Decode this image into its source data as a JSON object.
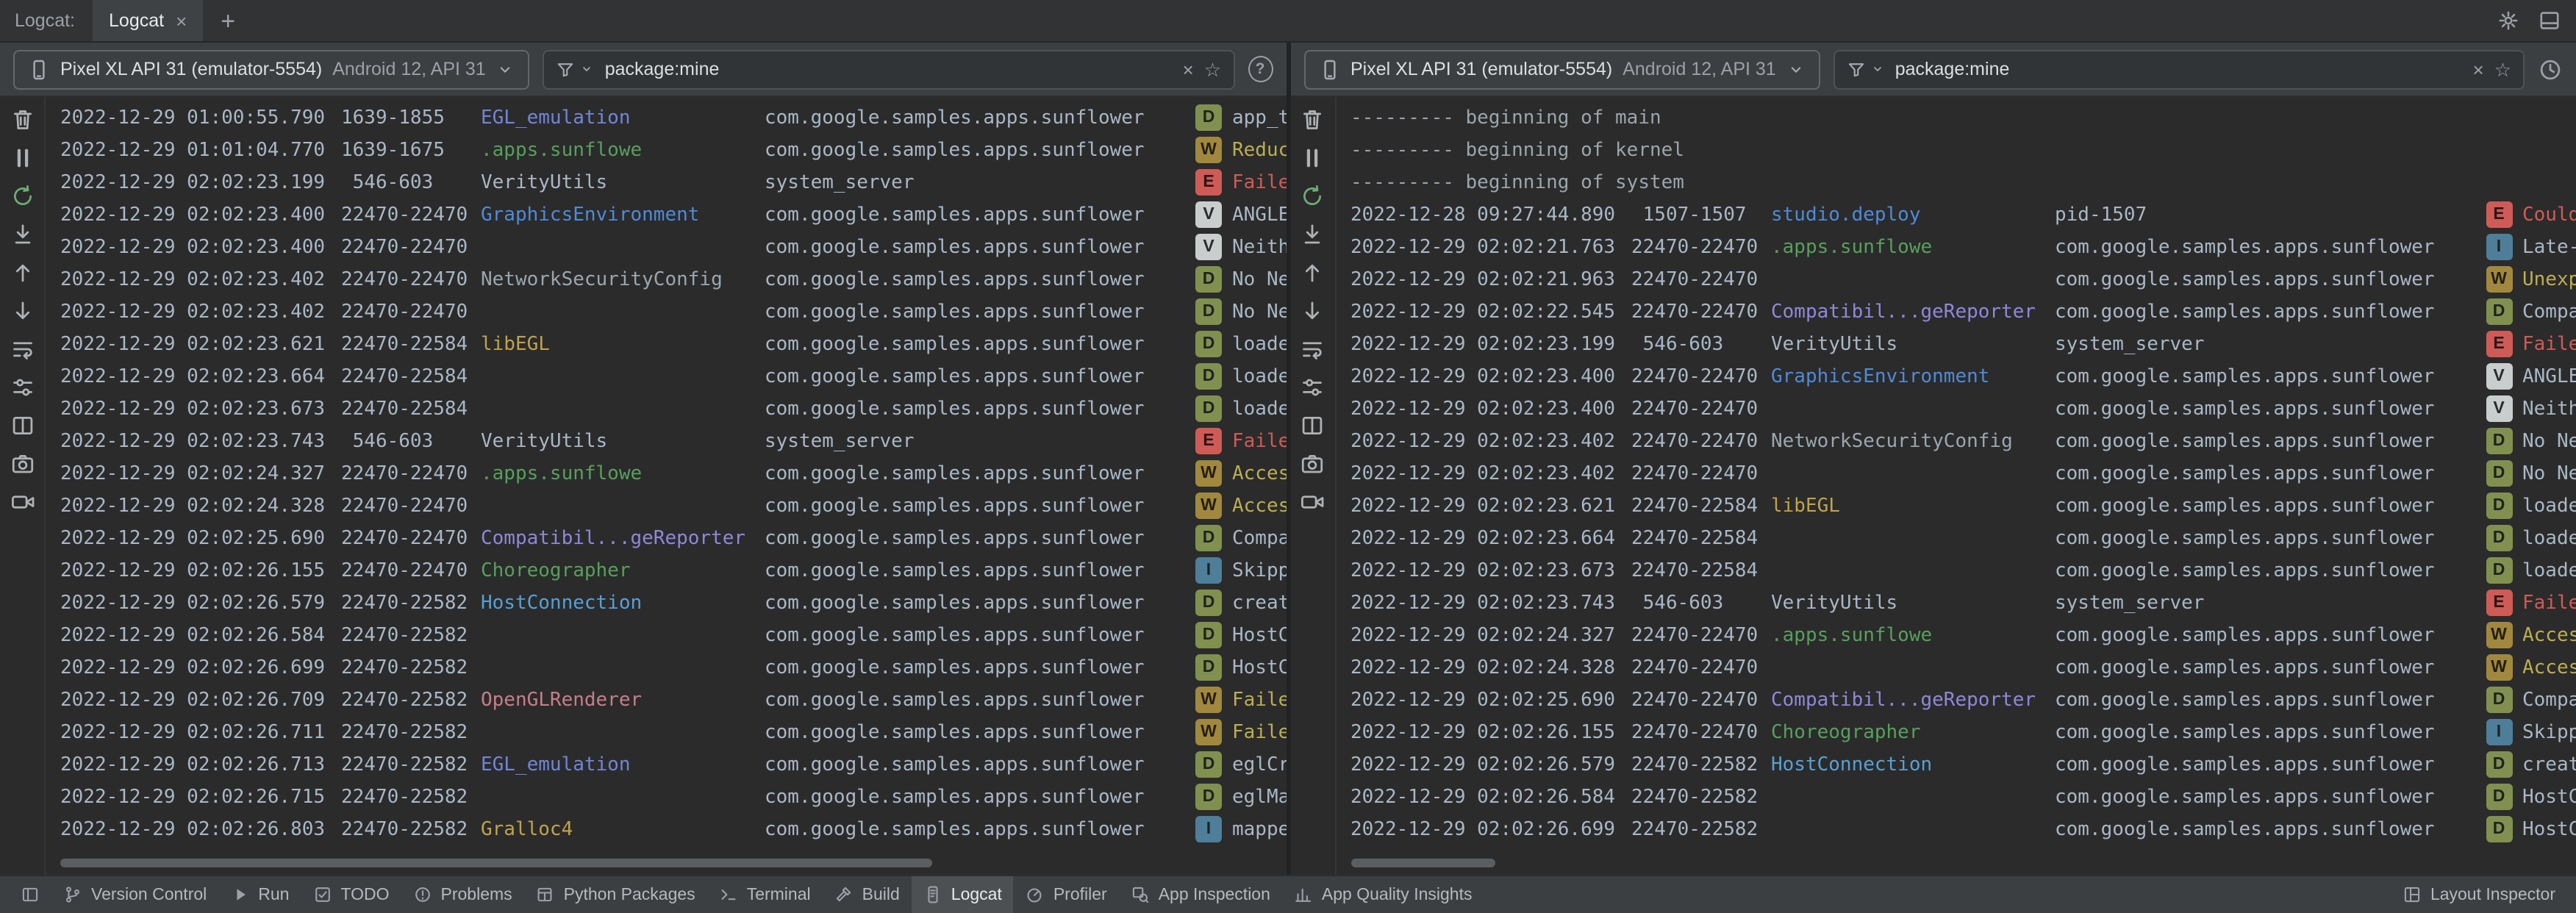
{
  "window": {
    "title": "Logcat:",
    "tab_label": "Logcat",
    "tab_close": "×",
    "new_tab": "+",
    "right_icons": [
      "gear",
      "dock"
    ]
  },
  "side_tools": [
    {
      "name": "trash"
    },
    {
      "name": "pause"
    },
    {
      "name": "restart",
      "color": "#6CAD74"
    },
    {
      "name": "scroll-end"
    },
    {
      "name": "arrow-up"
    },
    {
      "name": "arrow-down"
    },
    {
      "name": "soft-wrap"
    },
    {
      "name": "config"
    },
    {
      "name": "split"
    },
    {
      "name": "camera"
    },
    {
      "name": "video"
    }
  ],
  "levels": {
    "V": {
      "bg": "#C9CDCE",
      "fg": "#2B2B2B"
    },
    "D": {
      "bg": "#81904F",
      "fg": "#1F2321"
    },
    "I": {
      "bg": "#4E7E99",
      "fg": "#1F2321"
    },
    "W": {
      "bg": "#A1883E",
      "fg": "#241F14"
    },
    "E": {
      "bg": "#CF5B56",
      "fg": "#2B1514"
    }
  },
  "msg_colors": {
    "E": "#CF5B56",
    "W": "#BBAE52",
    "default": "#A9B7C6"
  },
  "tag_colors": {
    "EGL_emulation": "#7086D9",
    ".apps.sunflowe": "#57A05C",
    "VerityUtils": "#A9B7C6",
    "GraphicsEnvironment": "#4E8AD8",
    "NetworkSecurityConfig": "#9AA6B0",
    "libEGL": "#BFA34C",
    "Compatibil...geReporter": "#8F87DB",
    "Choreographer": "#57A05C",
    "HostConnection": "#56A0D6",
    "OpenGLRenderer": "#C77D8C",
    "Gralloc4": "#BFA34C",
    "studio.deploy": "#4E8AD8"
  },
  "panels": [
    {
      "device": {
        "name": "Pixel XL API 31 (emulator-5554)",
        "details": "Android 12, API 31"
      },
      "filter": {
        "value": "package:mine",
        "clear": "×",
        "favorite": "☆"
      },
      "trailing": {
        "name": "help",
        "glyph": "?"
      },
      "scroll": {
        "left": "0%",
        "width": "72%"
      },
      "rows": [
        {
          "time": "2022-12-29 01:00:55.790",
          "pid": "1639-1855",
          "tag": "EGL_emulation",
          "pkg": "com.google.samples.apps.sunflower",
          "lvl": "D",
          "msg": "app_t"
        },
        {
          "time": "2022-12-29 01:01:04.770",
          "pid": "1639-1675",
          "tag": ".apps.sunflowe",
          "pkg": "com.google.samples.apps.sunflower",
          "lvl": "W",
          "msg": "Reduc"
        },
        {
          "time": "2022-12-29 02:02:23.199",
          "pid": " 546-603",
          "tag": "VerityUtils",
          "pkg": "system_server",
          "lvl": "E",
          "msg": "Faile"
        },
        {
          "time": "2022-12-29 02:02:23.400",
          "pid": "22470-22470",
          "tag": "GraphicsEnvironment",
          "pkg": "com.google.samples.apps.sunflower",
          "lvl": "V",
          "msg": "ANGLE"
        },
        {
          "time": "2022-12-29 02:02:23.400",
          "pid": "22470-22470",
          "tag": "",
          "pkg": "com.google.samples.apps.sunflower",
          "lvl": "V",
          "msg": "Neith"
        },
        {
          "time": "2022-12-29 02:02:23.402",
          "pid": "22470-22470",
          "tag": "NetworkSecurityConfig",
          "pkg": "com.google.samples.apps.sunflower",
          "lvl": "D",
          "msg": "No Ne"
        },
        {
          "time": "2022-12-29 02:02:23.402",
          "pid": "22470-22470",
          "tag": "",
          "pkg": "com.google.samples.apps.sunflower",
          "lvl": "D",
          "msg": "No Ne"
        },
        {
          "time": "2022-12-29 02:02:23.621",
          "pid": "22470-22584",
          "tag": "libEGL",
          "pkg": "com.google.samples.apps.sunflower",
          "lvl": "D",
          "msg": "loade"
        },
        {
          "time": "2022-12-29 02:02:23.664",
          "pid": "22470-22584",
          "tag": "",
          "pkg": "com.google.samples.apps.sunflower",
          "lvl": "D",
          "msg": "loade"
        },
        {
          "time": "2022-12-29 02:02:23.673",
          "pid": "22470-22584",
          "tag": "",
          "pkg": "com.google.samples.apps.sunflower",
          "lvl": "D",
          "msg": "loade"
        },
        {
          "time": "2022-12-29 02:02:23.743",
          "pid": " 546-603",
          "tag": "VerityUtils",
          "pkg": "system_server",
          "lvl": "E",
          "msg": "Faile"
        },
        {
          "time": "2022-12-29 02:02:24.327",
          "pid": "22470-22470",
          "tag": ".apps.sunflowe",
          "pkg": "com.google.samples.apps.sunflower",
          "lvl": "W",
          "msg": "Acces"
        },
        {
          "time": "2022-12-29 02:02:24.328",
          "pid": "22470-22470",
          "tag": "",
          "pkg": "com.google.samples.apps.sunflower",
          "lvl": "W",
          "msg": "Acces"
        },
        {
          "time": "2022-12-29 02:02:25.690",
          "pid": "22470-22470",
          "tag": "Compatibil...geReporter",
          "pkg": "com.google.samples.apps.sunflower",
          "lvl": "D",
          "msg": "Compa"
        },
        {
          "time": "2022-12-29 02:02:26.155",
          "pid": "22470-22470",
          "tag": "Choreographer",
          "pkg": "com.google.samples.apps.sunflower",
          "lvl": "I",
          "msg": "Skipp"
        },
        {
          "time": "2022-12-29 02:02:26.579",
          "pid": "22470-22582",
          "tag": "HostConnection",
          "pkg": "com.google.samples.apps.sunflower",
          "lvl": "D",
          "msg": "creat"
        },
        {
          "time": "2022-12-29 02:02:26.584",
          "pid": "22470-22582",
          "tag": "",
          "pkg": "com.google.samples.apps.sunflower",
          "lvl": "D",
          "msg": "HostC"
        },
        {
          "time": "2022-12-29 02:02:26.699",
          "pid": "22470-22582",
          "tag": "",
          "pkg": "com.google.samples.apps.sunflower",
          "lvl": "D",
          "msg": "HostC"
        },
        {
          "time": "2022-12-29 02:02:26.709",
          "pid": "22470-22582",
          "tag": "OpenGLRenderer",
          "pkg": "com.google.samples.apps.sunflower",
          "lvl": "W",
          "msg": "Faile"
        },
        {
          "time": "2022-12-29 02:02:26.711",
          "pid": "22470-22582",
          "tag": "",
          "pkg": "com.google.samples.apps.sunflower",
          "lvl": "W",
          "msg": "Faile"
        },
        {
          "time": "2022-12-29 02:02:26.713",
          "pid": "22470-22582",
          "tag": "EGL_emulation",
          "pkg": "com.google.samples.apps.sunflower",
          "lvl": "D",
          "msg": "eglCr"
        },
        {
          "time": "2022-12-29 02:02:26.715",
          "pid": "22470-22582",
          "tag": "",
          "pkg": "com.google.samples.apps.sunflower",
          "lvl": "D",
          "msg": "eglMa"
        },
        {
          "time": "2022-12-29 02:02:26.803",
          "pid": "22470-22582",
          "tag": "Gralloc4",
          "pkg": "com.google.samples.apps.sunflower",
          "lvl": "I",
          "msg": "mappe"
        }
      ]
    },
    {
      "device": {
        "name": "Pixel XL API 31 (emulator-5554)",
        "details": "Android 12, API 31"
      },
      "filter": {
        "value": "package:mine",
        "clear": "×",
        "favorite": "☆"
      },
      "trailing": {
        "name": "clock"
      },
      "scroll": {
        "left": "0%",
        "width": "12%"
      },
      "rows": [
        {
          "sep": "--------- beginning of main"
        },
        {
          "sep": "--------- beginning of kernel"
        },
        {
          "sep": "--------- beginning of system"
        },
        {
          "time": "2022-12-28 09:27:44.890",
          "pid": " 1507-1507",
          "tag": "studio.deploy",
          "pkg": "pid-1507",
          "lvl": "E",
          "msg": "Could"
        },
        {
          "time": "2022-12-29 02:02:21.763",
          "pid": "22470-22470",
          "tag": ".apps.sunflowe",
          "pkg": "com.google.samples.apps.sunflower",
          "lvl": "I",
          "msg": "Late-"
        },
        {
          "time": "2022-12-29 02:02:21.963",
          "pid": "22470-22470",
          "tag": "",
          "pkg": "com.google.samples.apps.sunflower",
          "lvl": "W",
          "msg": "Unexp"
        },
        {
          "time": "2022-12-29 02:02:22.545",
          "pid": "22470-22470",
          "tag": "Compatibil...geReporter",
          "pkg": "com.google.samples.apps.sunflower",
          "lvl": "D",
          "msg": "Compa"
        },
        {
          "time": "2022-12-29 02:02:23.199",
          "pid": " 546-603",
          "tag": "VerityUtils",
          "pkg": "system_server",
          "lvl": "E",
          "msg": "Faile"
        },
        {
          "time": "2022-12-29 02:02:23.400",
          "pid": "22470-22470",
          "tag": "GraphicsEnvironment",
          "pkg": "com.google.samples.apps.sunflower",
          "lvl": "V",
          "msg": "ANGLE"
        },
        {
          "time": "2022-12-29 02:02:23.400",
          "pid": "22470-22470",
          "tag": "",
          "pkg": "com.google.samples.apps.sunflower",
          "lvl": "V",
          "msg": "Neith"
        },
        {
          "time": "2022-12-29 02:02:23.402",
          "pid": "22470-22470",
          "tag": "NetworkSecurityConfig",
          "pkg": "com.google.samples.apps.sunflower",
          "lvl": "D",
          "msg": "No Ne"
        },
        {
          "time": "2022-12-29 02:02:23.402",
          "pid": "22470-22470",
          "tag": "",
          "pkg": "com.google.samples.apps.sunflower",
          "lvl": "D",
          "msg": "No Ne"
        },
        {
          "time": "2022-12-29 02:02:23.621",
          "pid": "22470-22584",
          "tag": "libEGL",
          "pkg": "com.google.samples.apps.sunflower",
          "lvl": "D",
          "msg": "loade"
        },
        {
          "time": "2022-12-29 02:02:23.664",
          "pid": "22470-22584",
          "tag": "",
          "pkg": "com.google.samples.apps.sunflower",
          "lvl": "D",
          "msg": "loade"
        },
        {
          "time": "2022-12-29 02:02:23.673",
          "pid": "22470-22584",
          "tag": "",
          "pkg": "com.google.samples.apps.sunflower",
          "lvl": "D",
          "msg": "loade"
        },
        {
          "time": "2022-12-29 02:02:23.743",
          "pid": " 546-603",
          "tag": "VerityUtils",
          "pkg": "system_server",
          "lvl": "E",
          "msg": "Faile"
        },
        {
          "time": "2022-12-29 02:02:24.327",
          "pid": "22470-22470",
          "tag": ".apps.sunflowe",
          "pkg": "com.google.samples.apps.sunflower",
          "lvl": "W",
          "msg": "Acces"
        },
        {
          "time": "2022-12-29 02:02:24.328",
          "pid": "22470-22470",
          "tag": "",
          "pkg": "com.google.samples.apps.sunflower",
          "lvl": "W",
          "msg": "Acces"
        },
        {
          "time": "2022-12-29 02:02:25.690",
          "pid": "22470-22470",
          "tag": "Compatibil...geReporter",
          "pkg": "com.google.samples.apps.sunflower",
          "lvl": "D",
          "msg": "Compa"
        },
        {
          "time": "2022-12-29 02:02:26.155",
          "pid": "22470-22470",
          "tag": "Choreographer",
          "pkg": "com.google.samples.apps.sunflower",
          "lvl": "I",
          "msg": "Skipp"
        },
        {
          "time": "2022-12-29 02:02:26.579",
          "pid": "22470-22582",
          "tag": "HostConnection",
          "pkg": "com.google.samples.apps.sunflower",
          "lvl": "D",
          "msg": "creat"
        },
        {
          "time": "2022-12-29 02:02:26.584",
          "pid": "22470-22582",
          "tag": "",
          "pkg": "com.google.samples.apps.sunflower",
          "lvl": "D",
          "msg": "HostC"
        },
        {
          "time": "2022-12-29 02:02:26.699",
          "pid": "22470-22582",
          "tag": "",
          "pkg": "com.google.samples.apps.sunflower",
          "lvl": "D",
          "msg": "HostC"
        }
      ]
    }
  ],
  "statusbar": {
    "left": [
      {
        "icon": "window",
        "label": ""
      },
      {
        "icon": "branch",
        "label": "Version Control"
      },
      {
        "icon": "play",
        "label": "Run"
      },
      {
        "icon": "todo",
        "label": "TODO"
      },
      {
        "icon": "problems",
        "label": "Problems"
      },
      {
        "icon": "package",
        "label": "Python Packages"
      },
      {
        "icon": "terminal",
        "label": "Terminal"
      },
      {
        "icon": "build",
        "label": "Build"
      },
      {
        "icon": "logcat",
        "label": "Logcat",
        "active": true
      },
      {
        "icon": "profiler",
        "label": "Profiler"
      },
      {
        "icon": "inspection",
        "label": "App Inspection"
      },
      {
        "icon": "insights",
        "label": "App Quality Insights"
      }
    ],
    "right": [
      {
        "icon": "layout",
        "label": "Layout Inspector"
      }
    ]
  }
}
